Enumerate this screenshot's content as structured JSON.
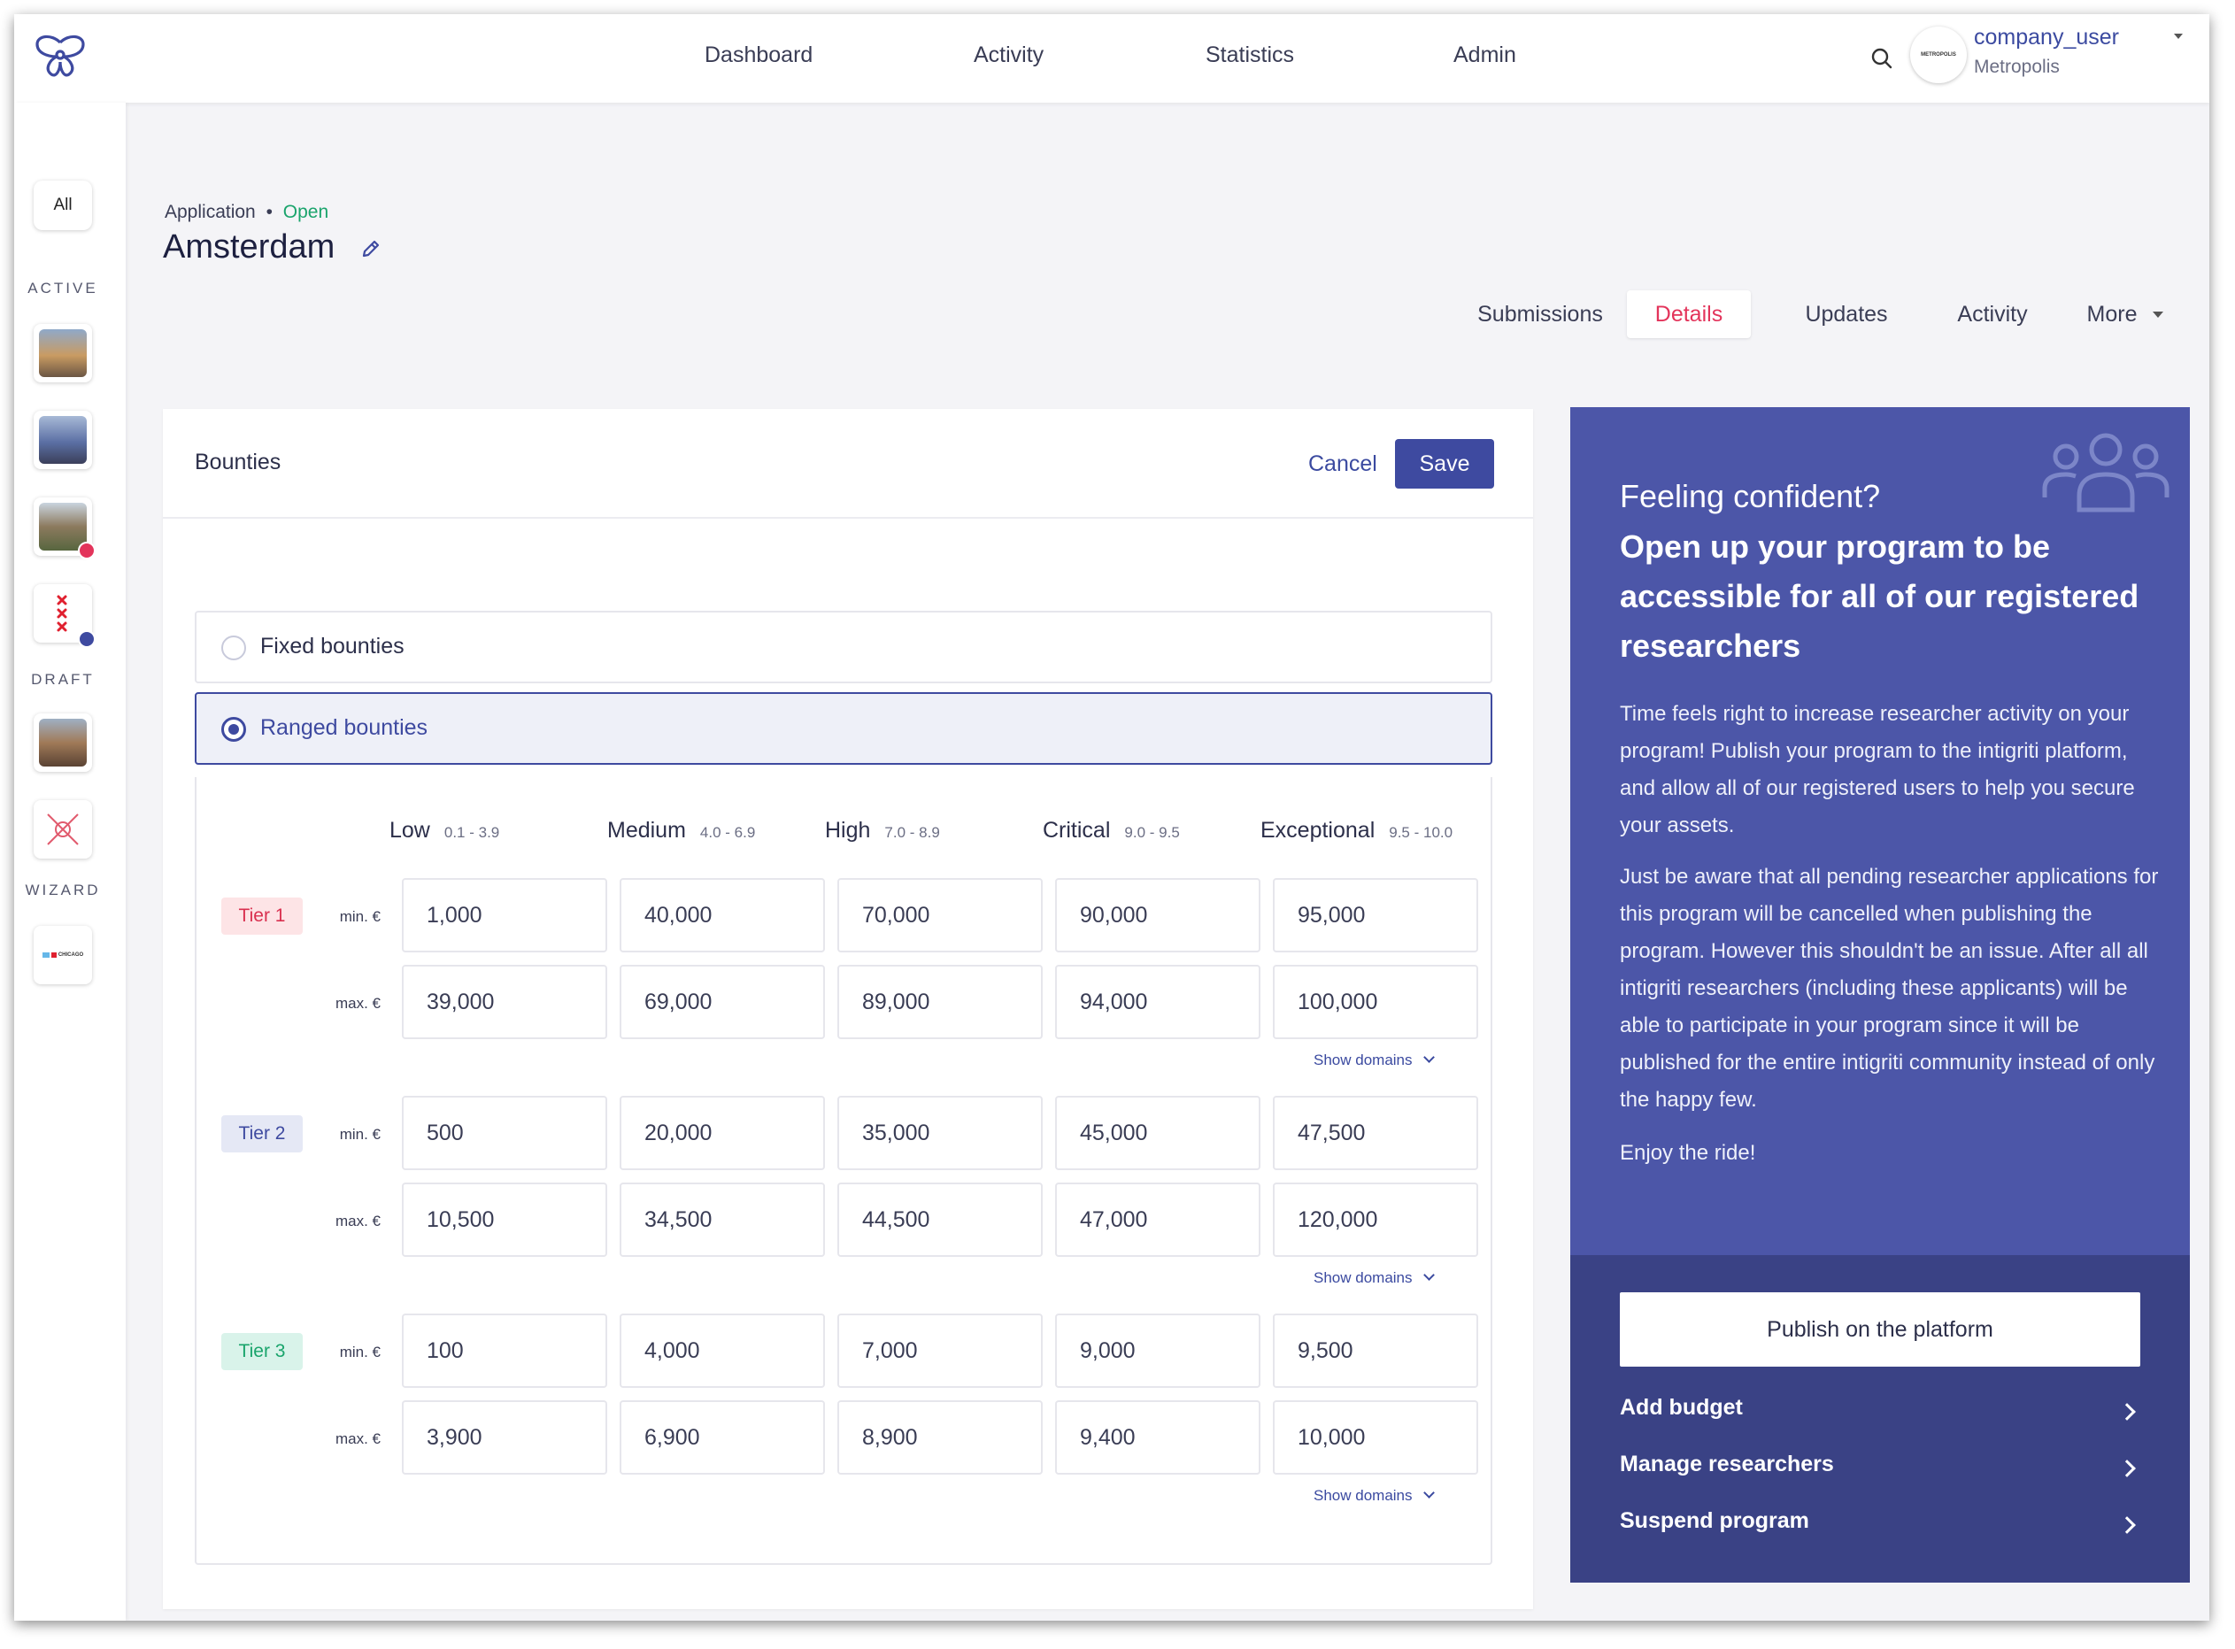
{
  "topbar": {
    "nav": [
      "Dashboard",
      "Activity",
      "Statistics",
      "Admin"
    ],
    "avatar_text": "METROPOLIS",
    "user_name": "company_user",
    "user_org": "Metropolis"
  },
  "sidebar": {
    "all_label": "All",
    "sections": [
      "ACTIVE",
      "DRAFT",
      "WIZARD"
    ],
    "wizard_item_text": "CHICAGO"
  },
  "header": {
    "breadcrumb_type": "Application",
    "breadcrumb_sep": "•",
    "breadcrumb_status": "Open",
    "title": "Amsterdam",
    "tabs": [
      "Submissions",
      "Details",
      "Updates",
      "Activity",
      "More"
    ],
    "active_tab": "Details"
  },
  "bounties": {
    "title": "Bounties",
    "cancel_label": "Cancel",
    "save_label": "Save",
    "options": [
      "Fixed bounties",
      "Ranged bounties"
    ],
    "selected_option": "Ranged bounties",
    "columns": [
      {
        "label": "Low",
        "range": "0.1 - 3.9"
      },
      {
        "label": "Medium",
        "range": "4.0 - 6.9"
      },
      {
        "label": "High",
        "range": "7.0 - 8.9"
      },
      {
        "label": "Critical",
        "range": "9.0 - 9.5"
      },
      {
        "label": "Exceptional",
        "range": "9.5 - 10.0"
      }
    ],
    "min_label": "min. €",
    "max_label": "max. €",
    "show_domains_label": "Show domains",
    "tiers": [
      {
        "label": "Tier 1",
        "min": [
          "1,000",
          "40,000",
          "70,000",
          "90,000",
          "95,000"
        ],
        "max": [
          "39,000",
          "69,000",
          "89,000",
          "94,000",
          "100,000"
        ]
      },
      {
        "label": "Tier 2",
        "min": [
          "500",
          "20,000",
          "35,000",
          "45,000",
          "47,500"
        ],
        "max": [
          "10,500",
          "34,500",
          "44,500",
          "47,000",
          "120,000"
        ]
      },
      {
        "label": "Tier 3",
        "min": [
          "100",
          "4,000",
          "7,000",
          "9,000",
          "9,500"
        ],
        "max": [
          "3,900",
          "6,900",
          "8,900",
          "9,400",
          "10,000"
        ]
      }
    ]
  },
  "promo": {
    "lead": "Feeling confident?",
    "title": "Open up your program to be accessible for all of our registered researchers",
    "paragraphs": [
      "Time feels right to increase researcher activity on your program! Publish your program to the intigriti platform, and allow all of our registered users to help you secure your assets.",
      "Just be aware that all pending researcher applications for this program will be cancelled when publishing the program. However this shouldn't be an issue. After all all intigriti researchers (including these applicants) will be able to participate in your program since it will be published for the entire intigriti community instead of only the happy few.",
      "Enjoy the ride!"
    ],
    "publish_label": "Publish on the platform",
    "links": [
      "Add budget",
      "Manage researchers",
      "Suspend program"
    ]
  },
  "colors": {
    "accent": "#3e4aa0",
    "promo_bg": "#4c56a8",
    "promo_footer": "#3a4285",
    "status_open": "#1aa46c",
    "active_tab": "#e3345b",
    "tier1": "#fde4e6",
    "tier2": "#e5e8f5",
    "tier3": "#d9f3ea"
  }
}
